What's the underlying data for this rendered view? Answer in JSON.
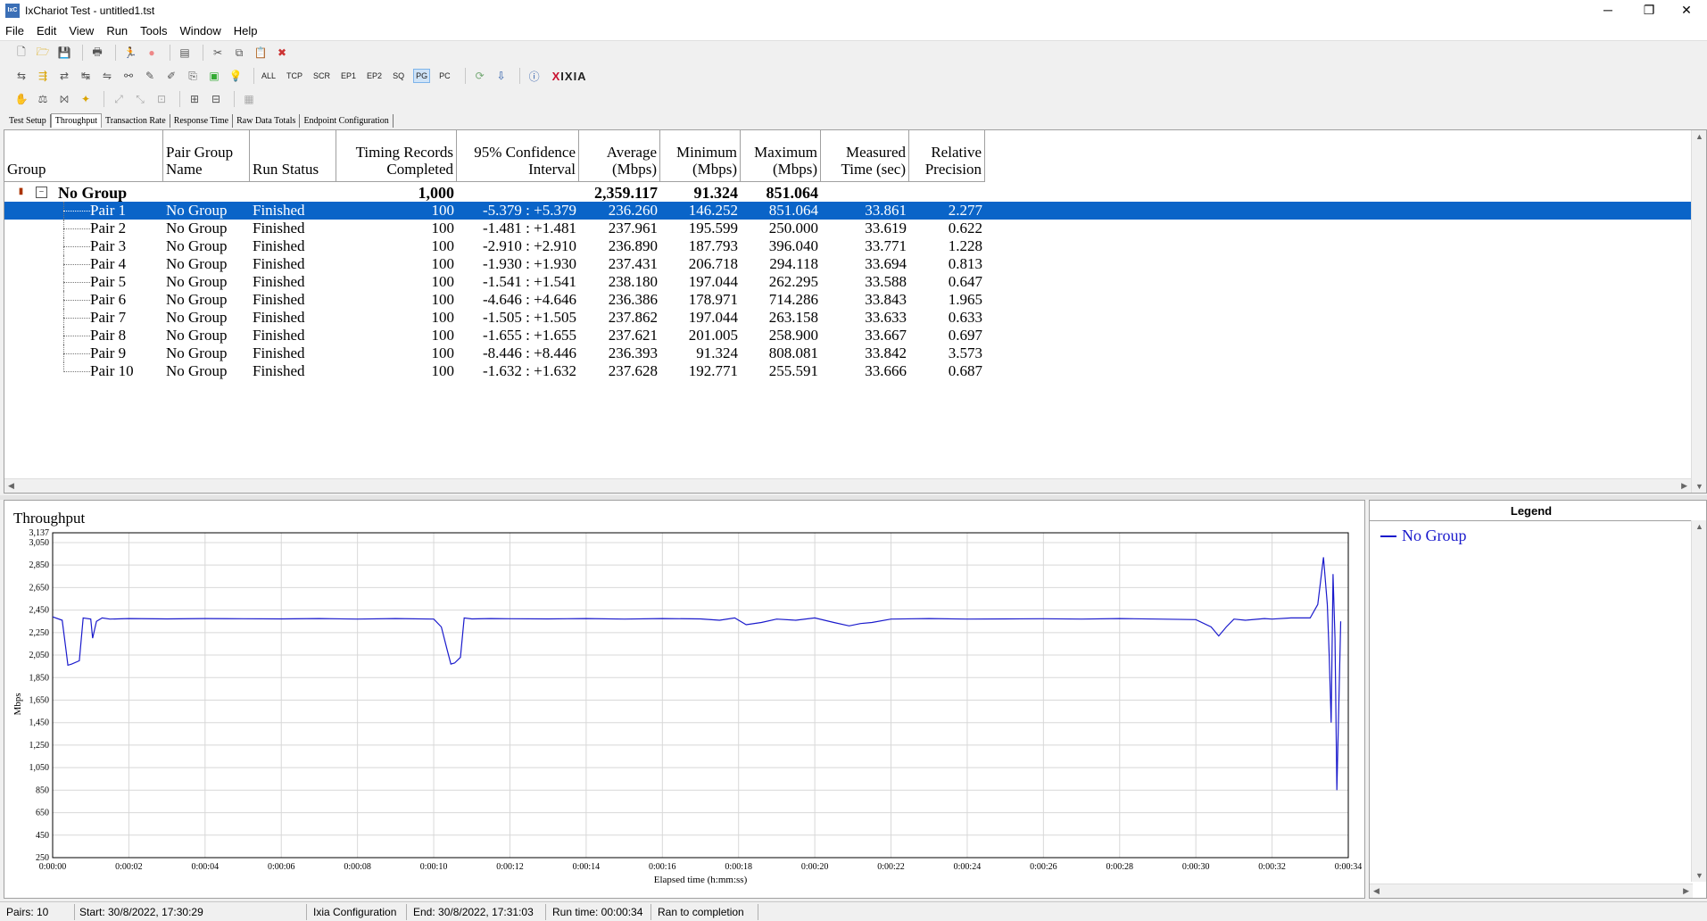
{
  "window": {
    "title": "IxChariot Test - untitled1.tst",
    "app_icon_text": "IxC",
    "minimize": "─",
    "restore": "❐",
    "close": "✕"
  },
  "menu": [
    "File",
    "Edit",
    "View",
    "Run",
    "Tools",
    "Window",
    "Help"
  ],
  "toolbar2_text_buttons": [
    "ALL",
    "TCP",
    "SCR",
    "EP1",
    "EP2",
    "SQ",
    "PG",
    "PC"
  ],
  "toolbar2_active": "PG",
  "logo": {
    "x": "X",
    "rest": "IXIA"
  },
  "tabs": [
    "Test Setup",
    "Throughput",
    "Transaction Rate",
    "Response Time",
    "Raw Data Totals",
    "Endpoint Configuration"
  ],
  "active_tab": "Throughput",
  "grid": {
    "headers": [
      [
        "",
        "Group"
      ],
      [
        "Pair Group",
        "Name"
      ],
      [
        "",
        "Run Status"
      ],
      [
        "Timing Records",
        "Completed"
      ],
      [
        "95% Confidence",
        "Interval"
      ],
      [
        "Average",
        "(Mbps)"
      ],
      [
        "Minimum",
        "(Mbps)"
      ],
      [
        "Maximum",
        "(Mbps)"
      ],
      [
        "Measured",
        "Time (sec)"
      ],
      [
        "Relative",
        "Precision"
      ]
    ],
    "group_row": {
      "name": "No Group",
      "records": "1,000",
      "average": "2,359.117",
      "minimum": "91.324",
      "maximum": "851.064"
    },
    "rows": [
      {
        "pair": "Pair 1",
        "group": "No Group",
        "status": "Finished",
        "records": "100",
        "ci": "-5.379 : +5.379",
        "avg": "236.260",
        "min": "146.252",
        "max": "851.064",
        "time": "33.861",
        "prec": "2.277"
      },
      {
        "pair": "Pair 2",
        "group": "No Group",
        "status": "Finished",
        "records": "100",
        "ci": "-1.481 : +1.481",
        "avg": "237.961",
        "min": "195.599",
        "max": "250.000",
        "time": "33.619",
        "prec": "0.622"
      },
      {
        "pair": "Pair 3",
        "group": "No Group",
        "status": "Finished",
        "records": "100",
        "ci": "-2.910 : +2.910",
        "avg": "236.890",
        "min": "187.793",
        "max": "396.040",
        "time": "33.771",
        "prec": "1.228"
      },
      {
        "pair": "Pair 4",
        "group": "No Group",
        "status": "Finished",
        "records": "100",
        "ci": "-1.930 : +1.930",
        "avg": "237.431",
        "min": "206.718",
        "max": "294.118",
        "time": "33.694",
        "prec": "0.813"
      },
      {
        "pair": "Pair 5",
        "group": "No Group",
        "status": "Finished",
        "records": "100",
        "ci": "-1.541 : +1.541",
        "avg": "238.180",
        "min": "197.044",
        "max": "262.295",
        "time": "33.588",
        "prec": "0.647"
      },
      {
        "pair": "Pair 6",
        "group": "No Group",
        "status": "Finished",
        "records": "100",
        "ci": "-4.646 : +4.646",
        "avg": "236.386",
        "min": "178.971",
        "max": "714.286",
        "time": "33.843",
        "prec": "1.965"
      },
      {
        "pair": "Pair 7",
        "group": "No Group",
        "status": "Finished",
        "records": "100",
        "ci": "-1.505 : +1.505",
        "avg": "237.862",
        "min": "197.044",
        "max": "263.158",
        "time": "33.633",
        "prec": "0.633"
      },
      {
        "pair": "Pair 8",
        "group": "No Group",
        "status": "Finished",
        "records": "100",
        "ci": "-1.655 : +1.655",
        "avg": "237.621",
        "min": "201.005",
        "max": "258.900",
        "time": "33.667",
        "prec": "0.697"
      },
      {
        "pair": "Pair 9",
        "group": "No Group",
        "status": "Finished",
        "records": "100",
        "ci": "-8.446 : +8.446",
        "avg": "236.393",
        "min": "91.324",
        "max": "808.081",
        "time": "33.842",
        "prec": "3.573"
      },
      {
        "pair": "Pair 10",
        "group": "No Group",
        "status": "Finished",
        "records": "100",
        "ci": "-1.632 : +1.632",
        "avg": "237.628",
        "min": "192.771",
        "max": "255.591",
        "time": "33.666",
        "prec": "0.687"
      }
    ]
  },
  "legend": {
    "title": "Legend",
    "entry": "No Group"
  },
  "status": {
    "pairs": "Pairs: 10",
    "start": "Start: 30/8/2022, 17:30:29",
    "config": "Ixia Configuration",
    "end": "End: 30/8/2022, 17:31:03",
    "runtime": "Run time: 00:00:34",
    "result": "Ran to completion"
  },
  "colors": {
    "series": "#1a1acc",
    "selection": "#0a64c8"
  },
  "chart_data": {
    "type": "line",
    "title": "Throughput",
    "xlabel": "Elapsed time (h:mm:ss)",
    "ylabel": "Mbps",
    "ylim": [
      250,
      3137
    ],
    "xlim": [
      0,
      34
    ],
    "yticks": [
      250,
      450,
      650,
      850,
      1050,
      1250,
      1450,
      1650,
      1850,
      2050,
      2250,
      2450,
      2650,
      2850,
      3050,
      3137
    ],
    "ytick_labels": [
      "250",
      "450",
      "650",
      "850",
      "1,050",
      "1,250",
      "1,450",
      "1,650",
      "1,850",
      "2,050",
      "2,250",
      "2,450",
      "2,650",
      "2,850",
      "3,050",
      "3,137"
    ],
    "xticks": [
      0,
      2,
      4,
      6,
      8,
      10,
      12,
      14,
      16,
      18,
      20,
      22,
      24,
      26,
      28,
      30,
      32,
      34
    ],
    "xtick_labels": [
      "0:00:00",
      "0:00:02",
      "0:00:04",
      "0:00:06",
      "0:00:08",
      "0:00:10",
      "0:00:12",
      "0:00:14",
      "0:00:16",
      "0:00:18",
      "0:00:20",
      "0:00:22",
      "0:00:24",
      "0:00:26",
      "0:00:28",
      "0:00:30",
      "0:00:32",
      "0:00:34"
    ],
    "grid": true,
    "legend": "right panel",
    "series": [
      {
        "name": "No Group",
        "color": "#1a1acc",
        "x": [
          0,
          0.25,
          0.35,
          0.4,
          0.5,
          0.7,
          0.8,
          1.0,
          1.05,
          1.15,
          1.3,
          1.5,
          2,
          3,
          4,
          5,
          6,
          7,
          8,
          9,
          10,
          10.2,
          10.35,
          10.45,
          10.55,
          10.7,
          10.8,
          11,
          11.5,
          12,
          13,
          14,
          15,
          16,
          17,
          17.5,
          17.9,
          18.2,
          18.6,
          19,
          19.5,
          20,
          20.5,
          20.9,
          21.2,
          21.5,
          22,
          23,
          24,
          25,
          26,
          27,
          28,
          29,
          30,
          30.4,
          30.6,
          30.8,
          31,
          31.3,
          31.8,
          32,
          32.5,
          33,
          33.2,
          33.35,
          33.45,
          33.5,
          33.55,
          33.6,
          33.65,
          33.7,
          33.75,
          33.8
        ],
        "y": [
          2390,
          2360,
          2100,
          1960,
          1970,
          2000,
          2380,
          2370,
          2200,
          2350,
          2380,
          2370,
          2375,
          2372,
          2375,
          2373,
          2372,
          2375,
          2370,
          2375,
          2370,
          2300,
          2100,
          1970,
          1980,
          2030,
          2380,
          2372,
          2375,
          2373,
          2372,
          2375,
          2370,
          2375,
          2372,
          2360,
          2380,
          2320,
          2340,
          2370,
          2360,
          2380,
          2340,
          2310,
          2330,
          2340,
          2370,
          2375,
          2370,
          2372,
          2373,
          2370,
          2375,
          2370,
          2365,
          2300,
          2220,
          2300,
          2370,
          2360,
          2375,
          2370,
          2380,
          2380,
          2500,
          2920,
          2500,
          2050,
          1450,
          2770,
          2200,
          850,
          1580,
          2350
        ]
      }
    ]
  }
}
